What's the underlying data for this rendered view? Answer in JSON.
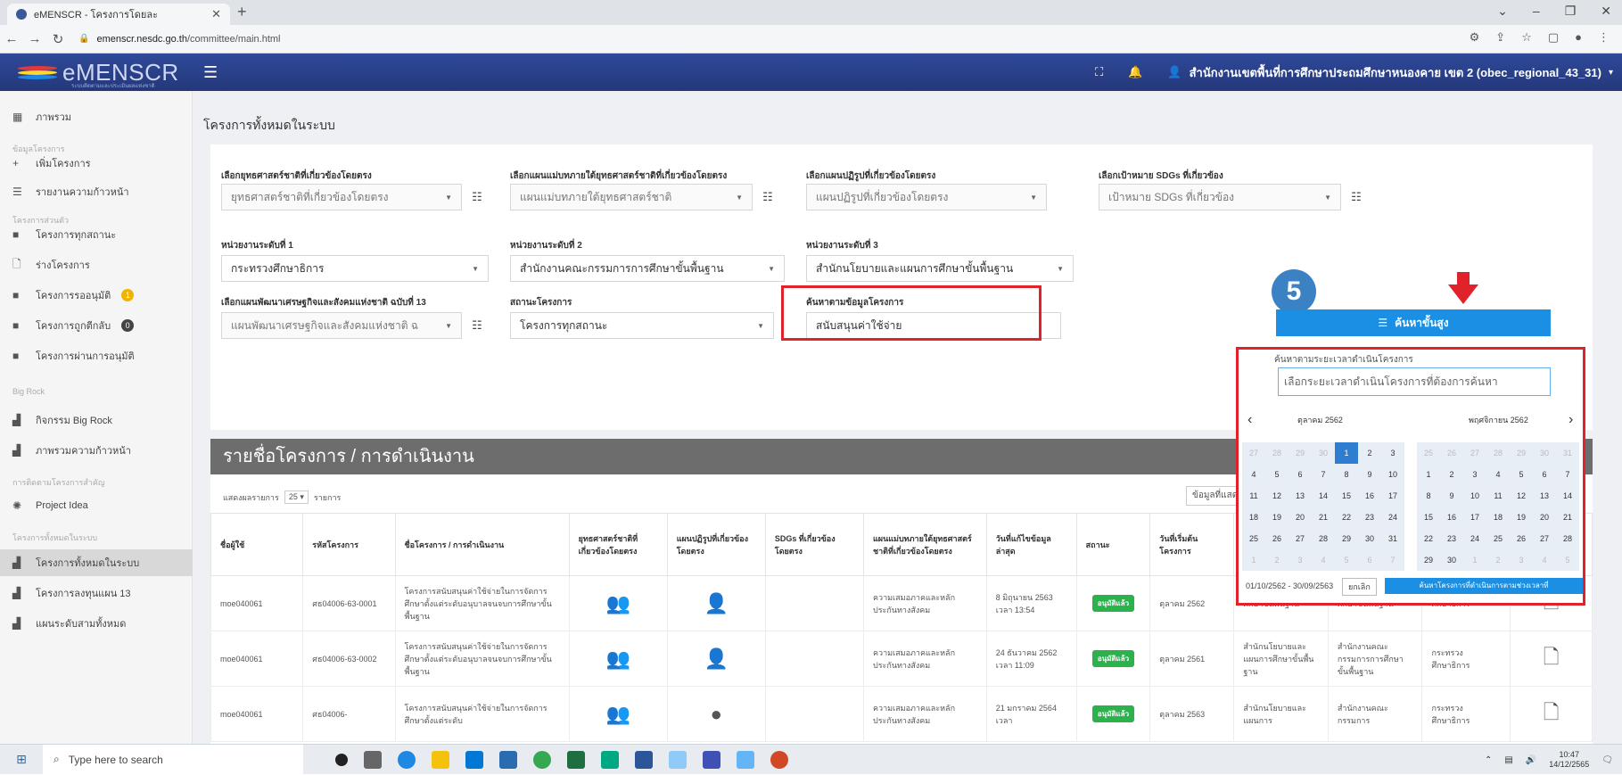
{
  "browser": {
    "tab_title": "eMENSCR - โครงการโดยละ",
    "url_host": "emenscr.nesdc.go.th",
    "url_path": "/committee/main.html"
  },
  "header": {
    "brand": "eMENSCR",
    "brand_sub": "ระบบติดตามและประเมินผลแห่งชาติ",
    "user": "สำนักงานเขตพื้นที่การศึกษาประถมศึกษาหนองคาย เขต 2 (obec_regional_43_31)"
  },
  "sidebar": {
    "items": [
      {
        "label": "ภาพรวม",
        "icon": "dashboard-icon"
      },
      {
        "label": "เพิ่มโครงการ",
        "icon": "plus-icon"
      },
      {
        "label": "รายงานความก้าวหน้า",
        "icon": "list-icon"
      },
      {
        "label": "โครงการทุกสถานะ",
        "icon": "folder-icon"
      },
      {
        "label": "ร่างโครงการ",
        "icon": "file-icon"
      },
      {
        "label": "โครงการรออนุมัติ",
        "icon": "folder-icon",
        "badge": "1"
      },
      {
        "label": "โครงการถูกตีกลับ",
        "icon": "folder-icon",
        "badge": "0"
      },
      {
        "label": "โครงการผ่านการอนุมัติ",
        "icon": "folder-icon"
      },
      {
        "label": "กิจกรรม Big Rock",
        "icon": "chart-icon"
      },
      {
        "label": "ภาพรวมความก้าวหน้า",
        "icon": "chart-icon"
      },
      {
        "label": "Project Idea",
        "icon": "bulb-icon"
      },
      {
        "label": "โครงการทั้งหมดในระบบ",
        "icon": "chart-icon"
      },
      {
        "label": "โครงการลงทุนแผน 13",
        "icon": "chart-icon"
      },
      {
        "label": "แผนระดับสามทั้งหมด",
        "icon": "chart-icon"
      }
    ],
    "headings": [
      "ข้อมูลโครงการ",
      "โครงการส่วนตัว",
      "Big Rock",
      "การติดตามโครงการสำคัญ",
      "โครงการทั้งหมดในระบบ"
    ]
  },
  "page": {
    "title": "โครงการทั้งหมดในระบบ"
  },
  "filters": {
    "strategy_label": "เลือกยุทธศาสตร์ชาติที่เกี่ยวข้องโดยตรง",
    "strategy_value": "ยุทธศาสตร์ชาติที่เกี่ยวข้องโดยตรง",
    "masterplan_label": "เลือกแผนแม่บทภายใต้ยุทธศาสตร์ชาติที่เกี่ยวข้องโดยตรง",
    "masterplan_value": "แผนแม่บทภายใต้ยุทธศาสตร์ชาติ",
    "reform_label": "เลือกแผนปฏิรูปที่เกี่ยวข้องโดยตรง",
    "reform_value": "แผนปฏิรูปที่เกี่ยวข้องโดยตรง",
    "sdg_label": "เลือกเป้าหมาย SDGs ที่เกี่ยวข้อง",
    "sdg_value": "เป้าหมาย SDGs ที่เกี่ยวข้อง",
    "unit1_label": "หน่วยงานระดับที่ 1",
    "unit1_value": "กระทรวงศึกษาธิการ",
    "unit2_label": "หน่วยงานระดับที่ 2",
    "unit2_value": "สำนักงานคณะกรรมการการศึกษาขั้นพื้นฐาน",
    "unit3_label": "หน่วยงานระดับที่ 3",
    "unit3_value": "สำนักนโยบายและแผนการศึกษาขั้นพื้นฐาน",
    "devplan_label": "เลือกแผนพัฒนาเศรษฐกิจและสังคมแห่งชาติ ฉบับที่ 13",
    "devplan_value": "แผนพัฒนาเศรษฐกิจและสังคมแห่งชาติ ฉ",
    "status_label": "สถานะโครงการ",
    "status_value": "โครงการทุกสถานะ",
    "search_label": "ค้นหาตามข้อมูลโครงการ",
    "search_value": "สนับสนุนค่าใช้จ่าย",
    "date_label": "ค้นหาตามระยะเวลาดำเนินโครงการ",
    "date_placeholder": "เลือกระยะเวลาดำเนินโครงการที่ต้องการค้นหา",
    "advanced_button": "ค้นหาขั้นสูง",
    "step_number": "5"
  },
  "datepicker": {
    "left_month": "ตุลาคม 2562",
    "right_month": "พฤศจิกายน 2562",
    "left_weeks": [
      [
        "27",
        "28",
        "29",
        "30",
        "1",
        "2",
        "3"
      ],
      [
        "4",
        "5",
        "6",
        "7",
        "8",
        "9",
        "10"
      ],
      [
        "11",
        "12",
        "13",
        "14",
        "15",
        "16",
        "17"
      ],
      [
        "18",
        "19",
        "20",
        "21",
        "22",
        "23",
        "24"
      ],
      [
        "25",
        "26",
        "27",
        "28",
        "29",
        "30",
        "31"
      ],
      [
        "1",
        "2",
        "3",
        "4",
        "5",
        "6",
        "7"
      ]
    ],
    "right_weeks": [
      [
        "25",
        "26",
        "27",
        "28",
        "29",
        "30",
        "31"
      ],
      [
        "1",
        "2",
        "3",
        "4",
        "5",
        "6",
        "7"
      ],
      [
        "8",
        "9",
        "10",
        "11",
        "12",
        "13",
        "14"
      ],
      [
        "15",
        "16",
        "17",
        "18",
        "19",
        "20",
        "21"
      ],
      [
        "22",
        "23",
        "24",
        "25",
        "26",
        "27",
        "28"
      ],
      [
        "29",
        "30",
        "1",
        "2",
        "3",
        "4",
        "5"
      ]
    ],
    "range": "01/10/2562 - 30/09/2563",
    "cancel": "ยกเลิก",
    "apply": "ค้นหาโครงการที่ดำเนินการตามช่วงเวลาที่"
  },
  "table": {
    "heading": "รายชื่อโครงการ / การดำเนินงาน",
    "show_label": "แสดงผลรายการ",
    "page_size": "25",
    "show_suffix": "รายการ",
    "column_visibility": "ข้อมูลที่แสดง",
    "columns": [
      "ชื่อผู้ใช้",
      "รหัสโครงการ",
      "ชื่อโครงการ / การดำเนินงาน",
      "ยุทธศาสตร์ชาติที่เกี่ยวข้องโดยตรง",
      "แผนปฏิรูปที่เกี่ยวข้องโดยตรง",
      "SDGs ที่เกี่ยวข้องโดยตรง",
      "แผนแม่บทภายใต้ยุทธศาสตร์ชาติที่เกี่ยวข้องโดยตรง",
      "วันที่แก้ไขข้อมูลล่าสุด",
      "สถานะ",
      "วันที่เริ่มต้นโครงการ"
    ],
    "rows": [
      {
        "user": "moe040061",
        "code": "ศธ04006-63-0001",
        "name": "โครงการสนับสนุนค่าใช้จ่ายในการจัดการศึกษาตั้งแต่ระดับอนุบาลจนจบการศึกษาขั้นพื้นฐาน",
        "plan": "ความเสมอภาคและหลักประกันทางสังคม",
        "updated": "8 มิถุนายน 2563 เวลา 13:54",
        "status": "อนุมัติแล้ว",
        "start": "ตุลาคม 2562",
        "unit_a": "ศึกษาขั้นพื้นฐาน",
        "unit_b": "ศึกษาขั้นพื้นฐาน",
        "unit_c": "ศึกษาธิการ"
      },
      {
        "user": "moe040061",
        "code": "ศธ04006-63-0002",
        "name": "โครงการสนับสนุนค่าใช้จ่ายในการจัดการศึกษาตั้งแต่ระดับอนุบาลจนจบการศึกษาขั้นพื้นฐาน",
        "plan": "ความเสมอภาคและหลักประกันทางสังคม",
        "updated": "24 ธันวาคม 2562 เวลา 11:09",
        "status": "อนุมัติแล้ว",
        "start": "ตุลาคม 2561",
        "unit_a": "สำนักนโยบายและแผนการศึกษาขั้นพื้นฐาน",
        "unit_b": "สำนักงานคณะกรรมการการศึกษาขั้นพื้นฐาน",
        "unit_c": "กระทรวงศึกษาธิการ"
      },
      {
        "user": "moe040061",
        "code": "ศธ04006-",
        "name": "โครงการสนับสนุนค่าใช้จ่ายในการจัดการศึกษาตั้งแต่ระดับ",
        "plan": "ความเสมอภาคและหลักประกันทางสังคม",
        "updated": "21 มกราคม 2564 เวลา",
        "status": "อนุมัติแล้ว",
        "start": "ตุลาคม 2563",
        "unit_a": "สำนักนโยบายและแผนการ",
        "unit_b": "สำนักงานคณะกรรมการ",
        "unit_c": "กระทรวงศึกษาธิการ"
      }
    ]
  },
  "taskbar": {
    "search_placeholder": "Type here to search",
    "time": "10:47",
    "date": "14/12/2565"
  }
}
